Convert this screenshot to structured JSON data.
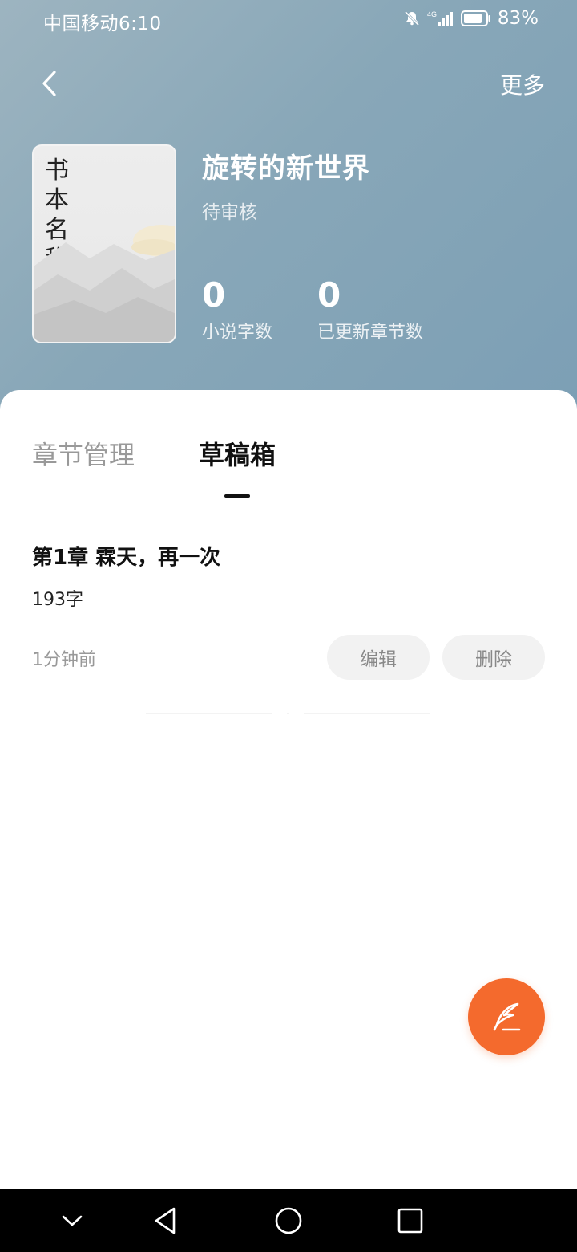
{
  "status_bar": {
    "carrier_time": "中国移动6:10",
    "network": "4G",
    "battery": "83%"
  },
  "nav": {
    "back_icon": "chevron-left-icon",
    "more_label": "更多"
  },
  "book": {
    "cover_text": "书本名称",
    "title": "旋转的新世界",
    "status": "待审核",
    "stats": [
      {
        "value": "0",
        "label": "小说字数"
      },
      {
        "value": "0",
        "label": "已更新章节数"
      }
    ]
  },
  "tabs": [
    {
      "label": "章节管理",
      "active": false
    },
    {
      "label": "草稿箱",
      "active": true
    }
  ],
  "drafts": [
    {
      "title": "第1章 霖天，再一次",
      "word_count": "193字",
      "time": "1分钟前",
      "edit_label": "编辑",
      "delete_label": "删除"
    }
  ],
  "fab": {
    "icon": "quill-pen-icon"
  },
  "colors": {
    "accent": "#f46a2d",
    "header_start": "#9db4c0",
    "header_end": "#7c9fb5"
  },
  "system_nav": [
    "chevron-down-icon",
    "back-triangle-icon",
    "home-circle-icon",
    "recents-square-icon"
  ]
}
